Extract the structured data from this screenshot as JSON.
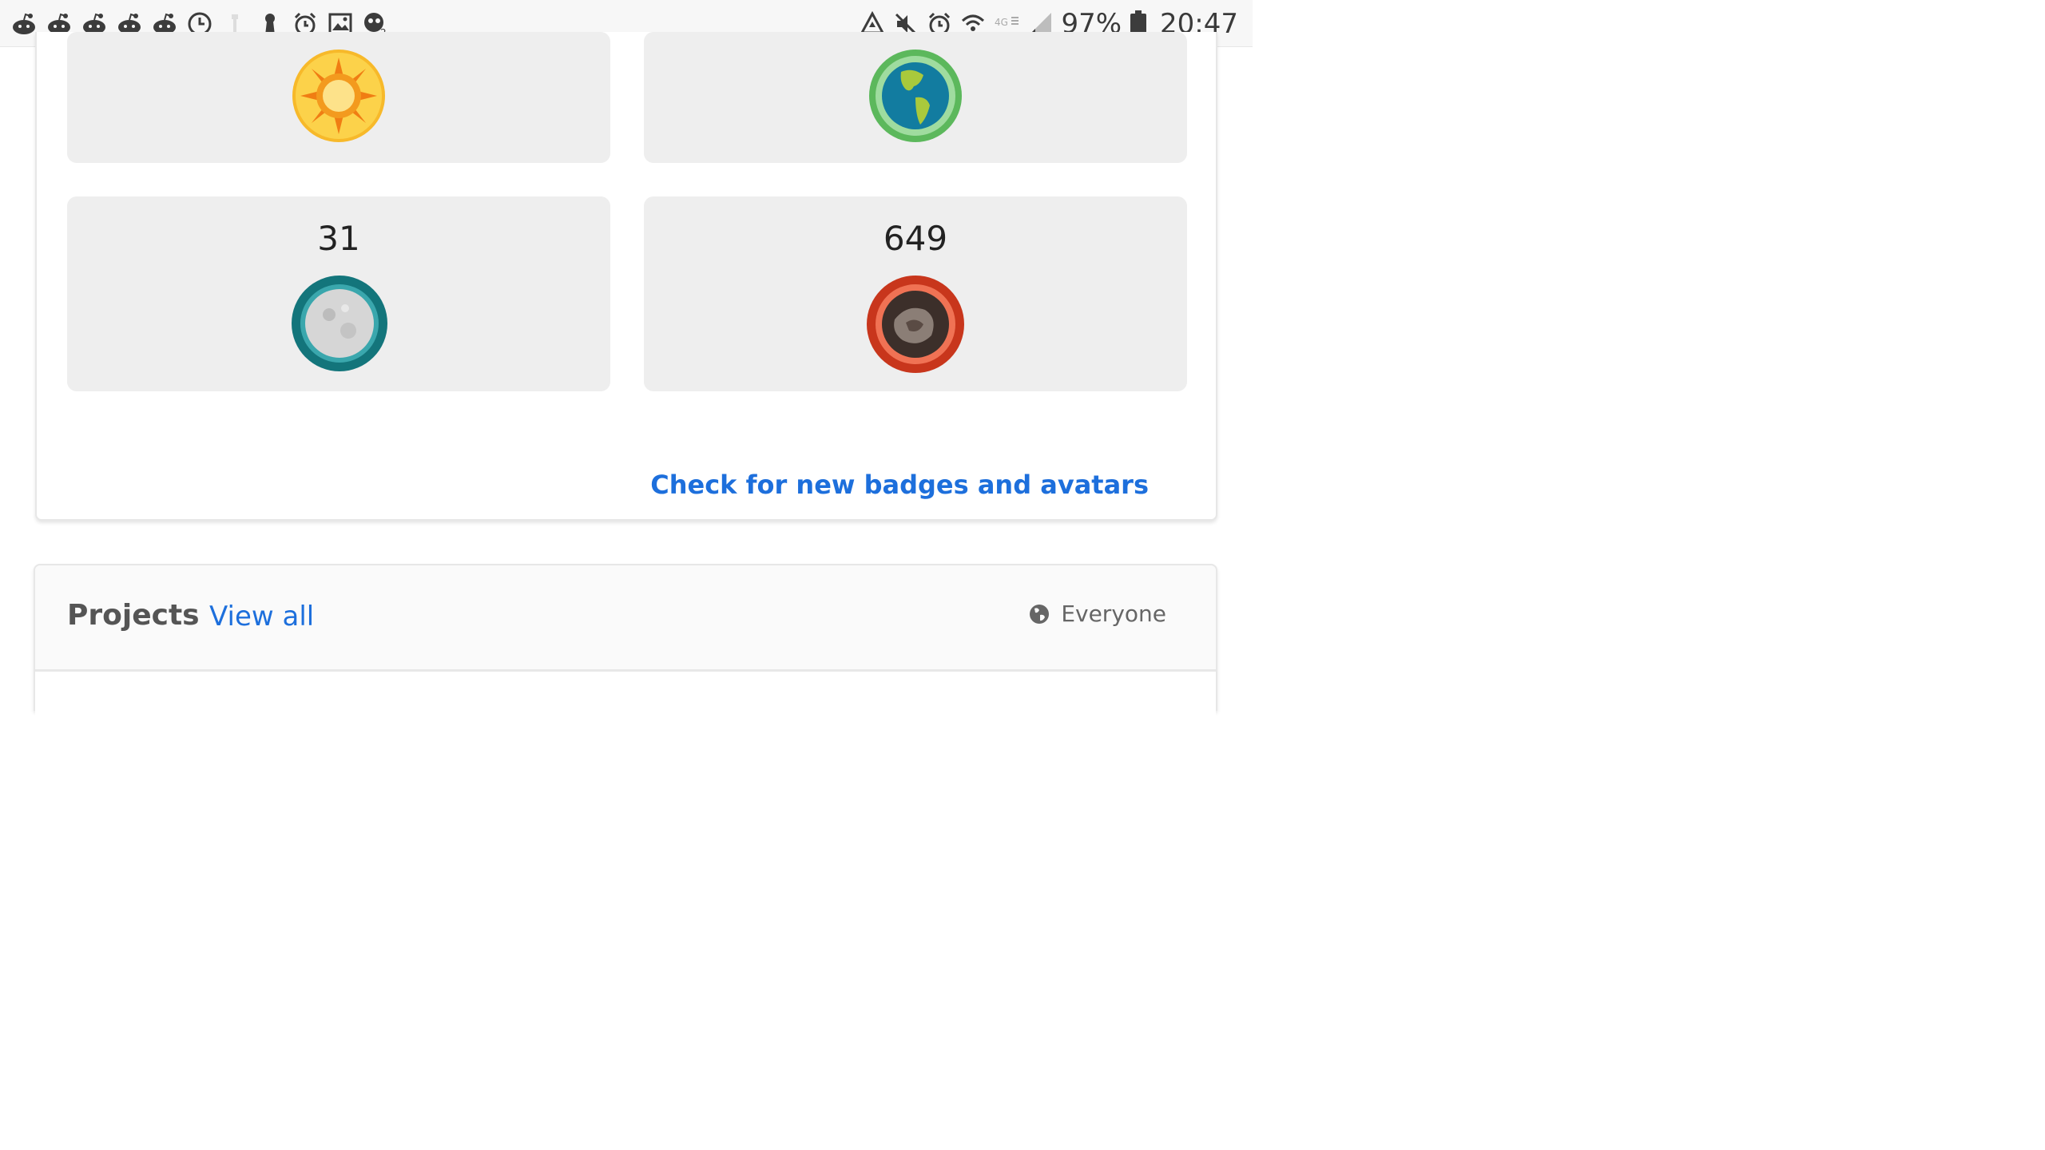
{
  "status_bar": {
    "left_icons": [
      "reddit-icon",
      "reddit-icon",
      "reddit-icon",
      "reddit-icon",
      "reddit-icon",
      "clock-icon",
      "tower-icon",
      "keyhole-icon",
      "alarm-icon",
      "image-icon",
      "game-icon"
    ],
    "battery_percent": "97%",
    "time": "20:47"
  },
  "badges": {
    "tiles": [
      {
        "count": "",
        "icon": "sun-badge-icon"
      },
      {
        "count": "",
        "icon": "earth-badge-icon"
      },
      {
        "count": "31",
        "icon": "moon-badge-icon"
      },
      {
        "count": "649",
        "icon": "mars-badge-icon"
      }
    ],
    "check_link": "Check for new badges and avatars"
  },
  "projects": {
    "title": "Projects",
    "view_all": "View all",
    "visibility": "Everyone"
  },
  "colors": {
    "link": "#1d6fdc",
    "tile_bg": "#eeeeee"
  }
}
